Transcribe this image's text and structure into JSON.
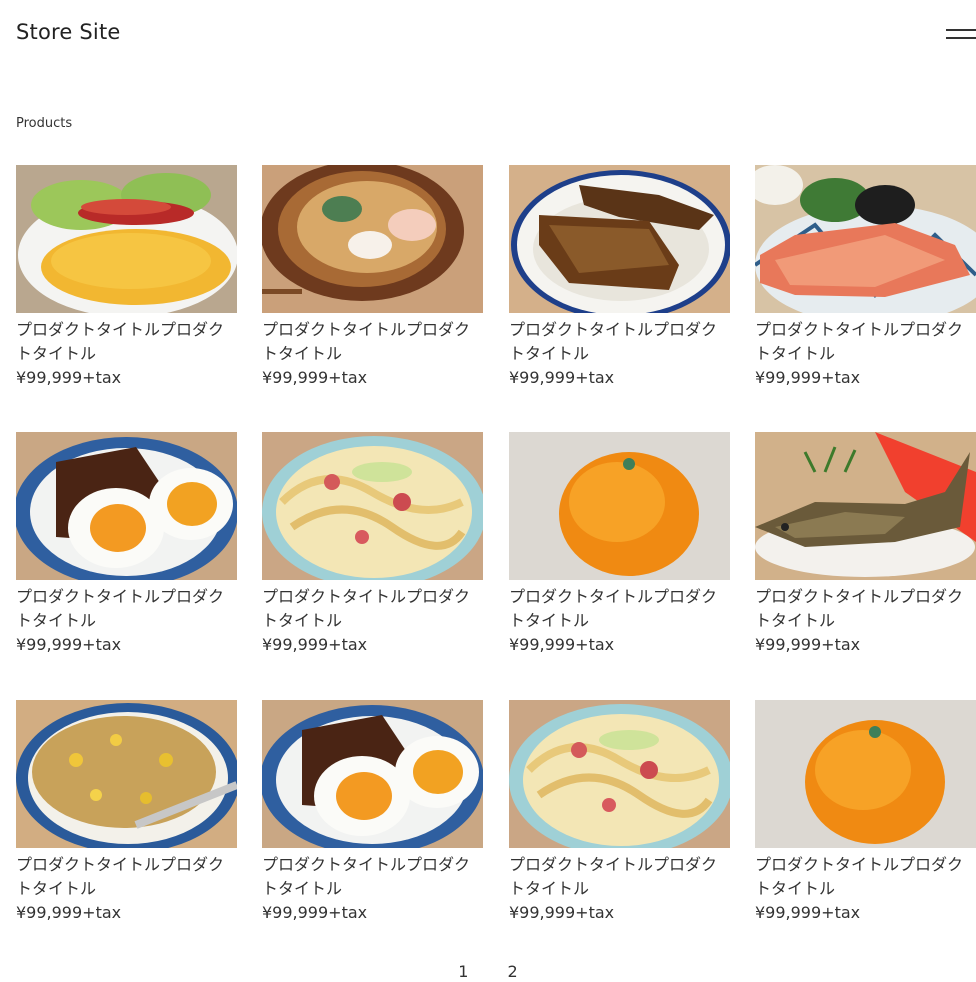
{
  "header": {
    "site_title": "Store Site",
    "menu_icon": "hamburger-icon"
  },
  "breadcrumb": "Products",
  "products": [
    {
      "title": "プロダクトタイトルプロダクトタイトル",
      "price": "¥99,999+tax",
      "image": "omelette-bacon"
    },
    {
      "title": "プロダクトタイトルプロダクトタイトル",
      "price": "¥99,999+tax",
      "image": "ramen-bowl"
    },
    {
      "title": "プロダクトタイトルプロダクトタイトル",
      "price": "¥99,999+tax",
      "image": "unagi-rice"
    },
    {
      "title": "プロダクトタイトルプロダクトタイトル",
      "price": "¥99,999+tax",
      "image": "grilled-salmon"
    },
    {
      "title": "プロダクトタイトルプロダクトタイトル",
      "price": "¥99,999+tax",
      "image": "eggs-meat"
    },
    {
      "title": "プロダクトタイトルプロダクトタイトル",
      "price": "¥99,999+tax",
      "image": "pasta"
    },
    {
      "title": "プロダクトタイトルプロダクトタイトル",
      "price": "¥99,999+tax",
      "image": "mandarin-orange"
    },
    {
      "title": "プロダクトタイトルプロダクトタイトル",
      "price": "¥99,999+tax",
      "image": "grilled-fish"
    },
    {
      "title": "プロダクトタイトルプロダクトタイトル",
      "price": "¥99,999+tax",
      "image": "fried-rice"
    },
    {
      "title": "プロダクトタイトルプロダクトタイトル",
      "price": "¥99,999+tax",
      "image": "eggs-meat"
    },
    {
      "title": "プロダクトタイトルプロダクトタイトル",
      "price": "¥99,999+tax",
      "image": "pasta"
    },
    {
      "title": "プロダクトタイトルプロダクトタイトル",
      "price": "¥99,999+tax",
      "image": "mandarin-orange"
    }
  ],
  "pagination": {
    "pages": [
      "1",
      "2"
    ]
  }
}
